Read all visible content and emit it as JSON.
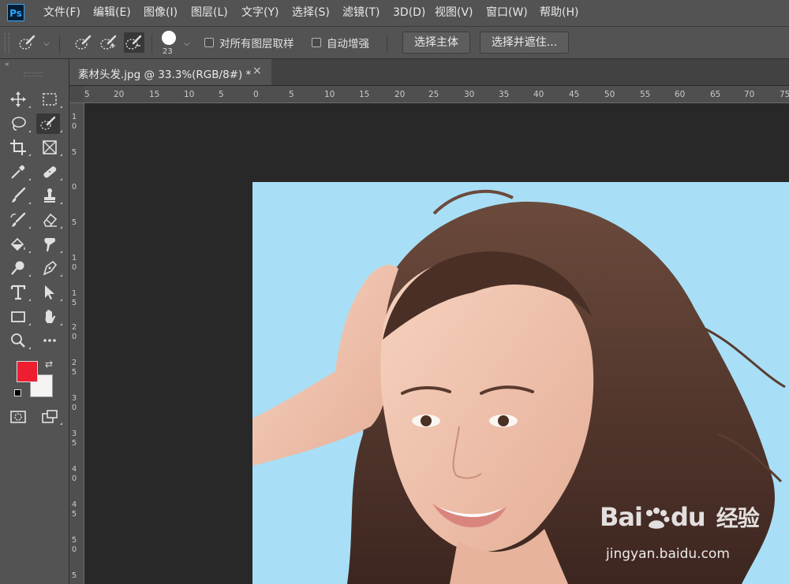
{
  "app": {
    "logo": "Ps"
  },
  "menu": [
    "文件(F)",
    "编辑(E)",
    "图像(I)",
    "图层(L)",
    "文字(Y)",
    "选择(S)",
    "滤镜(T)",
    "3D(D)",
    "视图(V)",
    "窗口(W)",
    "帮助(H)"
  ],
  "options": {
    "brush_size": "23",
    "sample_all_layers": {
      "label": "对所有图层取样",
      "checked": false
    },
    "auto_enhance": {
      "label": "自动增强",
      "checked": false
    },
    "select_subject": "选择主体",
    "select_and_mask": "选择并遮住..."
  },
  "toolbar": {
    "collapse": "«",
    "foreground_color": "#ee1d2f",
    "background_color": "#f6f4f2"
  },
  "document": {
    "tab_title": "素材头发.jpg @ 33.3%(RGB/8#) *",
    "close_glyph": "×"
  },
  "rulers": {
    "horizontal_labels": [
      "5",
      "20",
      "15",
      "10",
      "5",
      "0",
      "5",
      "10",
      "15",
      "20",
      "25",
      "30",
      "35",
      "40",
      "45",
      "50",
      "55",
      "60",
      "65",
      "70",
      "75"
    ],
    "vertical_labels": [
      [
        "1",
        "0"
      ],
      [
        "5"
      ],
      [
        "0"
      ],
      [
        "5"
      ],
      [
        "1",
        "0"
      ],
      [
        "1",
        "5"
      ],
      [
        "2",
        "0"
      ],
      [
        "2",
        "5"
      ],
      [
        "3",
        "0"
      ],
      [
        "3",
        "5"
      ],
      [
        "4",
        "0"
      ],
      [
        "4",
        "5"
      ],
      [
        "5",
        "0"
      ],
      [
        "5"
      ]
    ]
  },
  "canvas": {
    "background_color": "#a8dff6",
    "watermark_brand_a": "Bai",
    "watermark_brand_b": "du",
    "watermark_cn": "经验",
    "watermark_url": "jingyan.baidu.com"
  }
}
